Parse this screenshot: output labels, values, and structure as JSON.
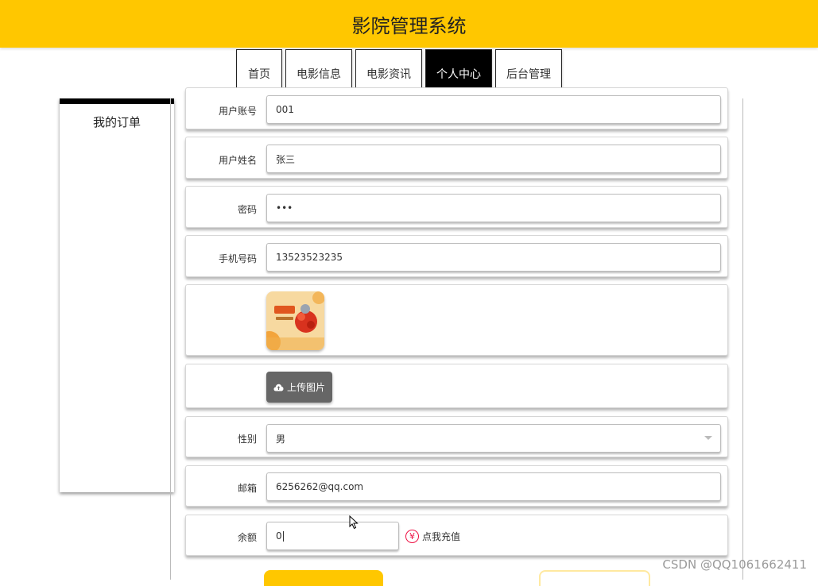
{
  "app": {
    "title": "影院管理系统"
  },
  "nav": {
    "tabs": [
      {
        "label": "首页"
      },
      {
        "label": "电影信息"
      },
      {
        "label": "电影资讯"
      },
      {
        "label": "个人中心",
        "active": true
      },
      {
        "label": "后台管理"
      }
    ]
  },
  "sidebar": {
    "items": [
      {
        "label": "我的订单"
      }
    ]
  },
  "form": {
    "account": {
      "label": "用户账号",
      "value": "001"
    },
    "name": {
      "label": "用户姓名",
      "value": "张三"
    },
    "password": {
      "label": "密码",
      "value": "•••"
    },
    "phone": {
      "label": "手机号码",
      "value": "13523523235"
    },
    "upload": {
      "label": "上传图片",
      "icon": "cloud-upload-icon"
    },
    "gender": {
      "label": "性别",
      "value": "男"
    },
    "email": {
      "label": "邮箱",
      "value": "6256262@qq.com"
    },
    "balance": {
      "label": "余额",
      "value": "0",
      "recharge_label": "点我充值",
      "recharge_icon": "yen-icon"
    }
  },
  "watermark": "CSDN @QQ1061662411",
  "colors": {
    "accent": "#ffc700",
    "nav_active": "#000000",
    "upload_button": "#666666",
    "recharge_icon": "#e11d48"
  }
}
